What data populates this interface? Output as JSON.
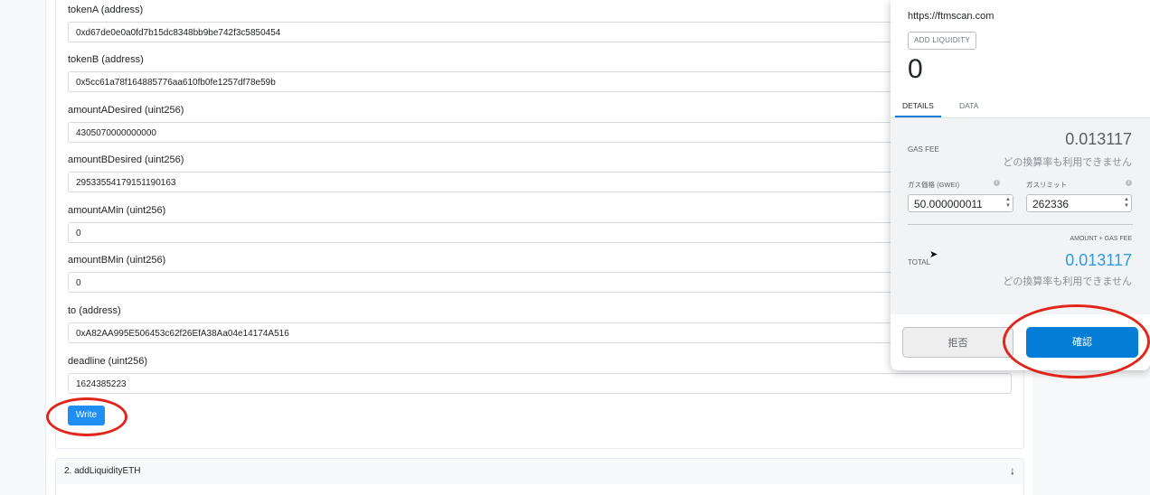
{
  "form": {
    "fields": [
      {
        "label": "tokenA (address)",
        "value": "0xd67de0e0a0fd7b15dc8348bb9be742f3c5850454"
      },
      {
        "label": "tokenB (address)",
        "value": "0x5cc61a78f164885776aa610fb0fe1257df78e59b"
      },
      {
        "label": "amountADesired (uint256)",
        "value": "4305070000000000"
      },
      {
        "label": "amountBDesired (uint256)",
        "value": "29533554179151190163"
      },
      {
        "label": "amountAMin (uint256)",
        "value": "0"
      },
      {
        "label": "amountBMin (uint256)",
        "value": "0"
      },
      {
        "label": "to (address)",
        "value": "0xA82AA995E506453c62f26EfA38Aa04e14174A516"
      },
      {
        "label": "deadline (uint256)",
        "value": "1624385223"
      }
    ],
    "write_label": "Write"
  },
  "next_section": {
    "title": "2. addLiquidityETH",
    "icon": "arrow-down-icon"
  },
  "wallet": {
    "origin": "https://ftmscan.com",
    "method_badge": "ADD LIQUIDITY",
    "amount": "0",
    "tabs": [
      "DETAILS",
      "DATA"
    ],
    "active_tab": "DETAILS",
    "gas_fee_label": "GAS FEE",
    "gas_fee_value": "0.013117",
    "conversion_unavailable": "どの換算率も利用できません",
    "gas_price_label": "ガス価格 (GWEI)",
    "gas_limit_label": "ガスリミット",
    "gas_price_value": "50.000000011",
    "gas_limit_value": "262336",
    "amount_plus_gas_label": "AMOUNT + GAS FEE",
    "total_label": "TOTAL",
    "total_value": "0.013117",
    "reject_label": "拒否",
    "confirm_label": "確認"
  },
  "colors": {
    "accent": "#037dd6",
    "write_button": "#1f8ff5",
    "annotation_ring": "#e0261b",
    "total_value": "#2f9ae0"
  }
}
